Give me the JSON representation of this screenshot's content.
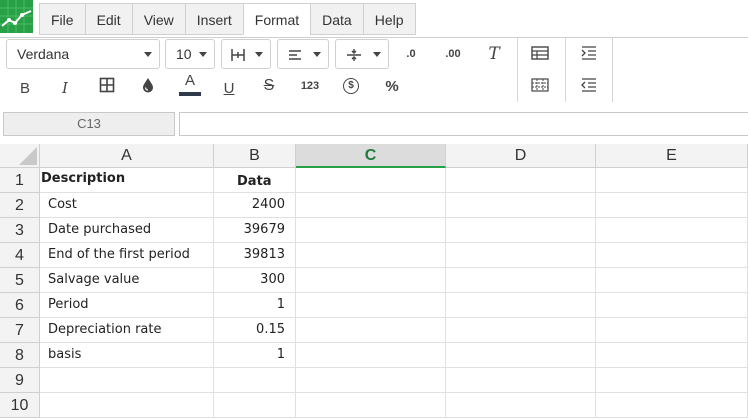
{
  "menu": {
    "items": [
      {
        "label": "File"
      },
      {
        "label": "Edit"
      },
      {
        "label": "View"
      },
      {
        "label": "Insert"
      },
      {
        "label": "Format"
      },
      {
        "label": "Data"
      },
      {
        "label": "Help"
      }
    ],
    "active": "Format"
  },
  "toolbar": {
    "font_name": "Verdana",
    "font_size": "10",
    "bold": "B",
    "italic": "I",
    "font_color": "A",
    "underline": "U",
    "strike": "S",
    "number_format": "123",
    "currency": "$",
    "percent": "%",
    "clear_format": "T",
    "decrease_decimal": ".0",
    "increase_decimal": ".00"
  },
  "formula_bar": {
    "cell_ref": "C13",
    "value": ""
  },
  "columns": [
    {
      "label": "A"
    },
    {
      "label": "B"
    },
    {
      "label": "C"
    },
    {
      "label": "D"
    },
    {
      "label": "E"
    }
  ],
  "rows": [
    {
      "num": "1",
      "a": "Description",
      "b": "Data"
    },
    {
      "num": "2",
      "a": "Cost",
      "b": "2400"
    },
    {
      "num": "3",
      "a": "Date purchased",
      "b": "39679"
    },
    {
      "num": "4",
      "a": "End of the first period",
      "b": "39813"
    },
    {
      "num": "5",
      "a": "Salvage value",
      "b": "300"
    },
    {
      "num": "6",
      "a": "Period",
      "b": "1"
    },
    {
      "num": "7",
      "a": "Depreciation rate",
      "b": "0.15"
    },
    {
      "num": "8",
      "a": "basis",
      "b": "1"
    },
    {
      "num": "9",
      "a": "",
      "b": ""
    },
    {
      "num": "10",
      "a": "",
      "b": ""
    }
  ],
  "colors": {
    "accent": "#27a046",
    "selected_col_text": "#1f7a3c"
  }
}
